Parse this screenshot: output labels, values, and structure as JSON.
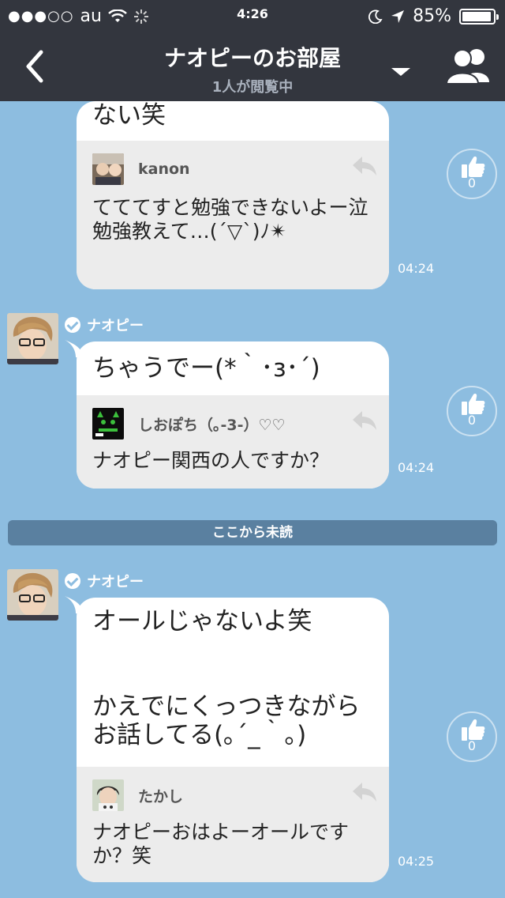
{
  "status_bar": {
    "carrier": "au",
    "signal_dots": "●●●○○",
    "time": "4:26",
    "battery": "85%"
  },
  "nav": {
    "title": "ナオピーのお部屋",
    "subtitle": "1人が閲覧中"
  },
  "messages": [
    {
      "text": "ない笑",
      "reply_name": "kanon",
      "reply_text": "てててすと勉強できないよー泣\n勉強教えて…(´▽`)ﾉ✴︎",
      "time": "04:24",
      "likes": "0"
    },
    {
      "sender": "ナオピー",
      "text": "ちゃうでー(*｀･з･´)",
      "reply_name": "しおぽち（｡-3-）♡♡",
      "reply_text": "ナオピー関西の人ですか？",
      "time": "04:24",
      "likes": "0"
    },
    {
      "sender": "ナオピー",
      "text": "オールじゃないよ笑\n\n\nかえでにくっつきながらお話してる(｡´_｀｡)",
      "reply_name": "たかし",
      "reply_text": "ナオピーおはよーオールですか？笑",
      "time": "04:25",
      "likes": "0"
    }
  ],
  "unread_divider": "ここから未読",
  "colors": {
    "background": "#8dbde0",
    "header": "#33363e",
    "divider": "#5a80a0"
  }
}
